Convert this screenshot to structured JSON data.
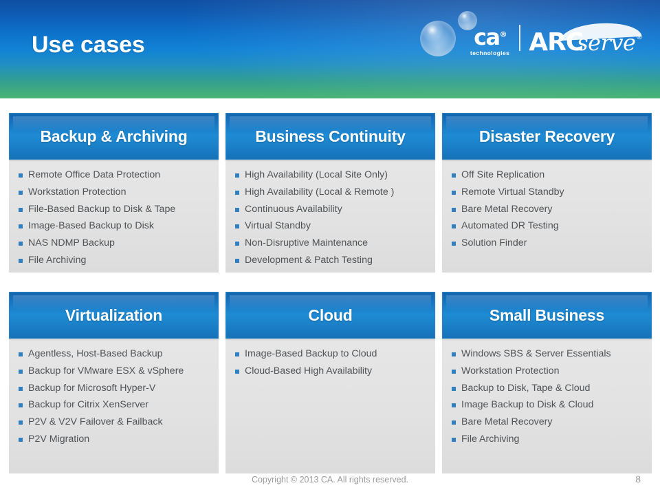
{
  "slide": {
    "title": "Use cases"
  },
  "logo": {
    "ca_text": "ca",
    "ca_registered": "®",
    "tagline": "technologies",
    "product_arc": "ARC",
    "product_serve": "serve",
    "product_registered": "®",
    "droplet_large": "water-droplet-large",
    "droplet_small": "water-droplet-small"
  },
  "panels": [
    {
      "id": "backup-archiving",
      "title": "Backup & Archiving",
      "items": [
        "Remote Office Data Protection",
        "Workstation Protection",
        "File-Based Backup to Disk & Tape",
        "Image-Based Backup to Disk",
        "NAS NDMP Backup",
        "File Archiving"
      ]
    },
    {
      "id": "business-continuity",
      "title": "Business Continuity",
      "items": [
        "High Availability (Local Site Only)",
        "High Availability (Local & Remote )",
        "Continuous Availability",
        "Virtual Standby",
        "Non-Disruptive Maintenance",
        "Development & Patch Testing"
      ]
    },
    {
      "id": "disaster-recovery",
      "title": "Disaster Recovery",
      "items": [
        "Off Site Replication",
        "Remote Virtual Standby",
        "Bare Metal Recovery",
        "Automated DR Testing",
        "Solution Finder"
      ]
    },
    {
      "id": "virtualization",
      "title": "Virtualization",
      "items": [
        "Agentless, Host-Based Backup",
        "Backup for VMware ESX & vSphere",
        "Backup for Microsoft Hyper-V",
        "Backup for Citrix XenServer",
        "P2V & V2V Failover & Failback",
        "P2V Migration"
      ]
    },
    {
      "id": "cloud",
      "title": "Cloud",
      "items": [
        "Image-Based Backup to Cloud",
        "Cloud-Based High Availability"
      ]
    },
    {
      "id": "small-business",
      "title": "Small Business",
      "items": [
        "Windows SBS & Server Essentials",
        "Workstation Protection",
        "Backup to Disk, Tape & Cloud",
        "Image Backup to Disk & Cloud",
        "Bare Metal Recovery",
        "File Archiving"
      ]
    }
  ],
  "footer": {
    "copyright": "Copyright © 2013 CA. All rights reserved.",
    "page_number": "8"
  },
  "colors": {
    "banner_top": "#0f4fa3",
    "banner_mid": "#1182d6",
    "banner_bottom": "#49b477",
    "header_blue": "#1e8bd4",
    "panel_body": "#e3e3e3",
    "bullet_blue": "#2f7fc1",
    "item_text": "#4f5356",
    "footer_text": "#9b9b9b"
  }
}
